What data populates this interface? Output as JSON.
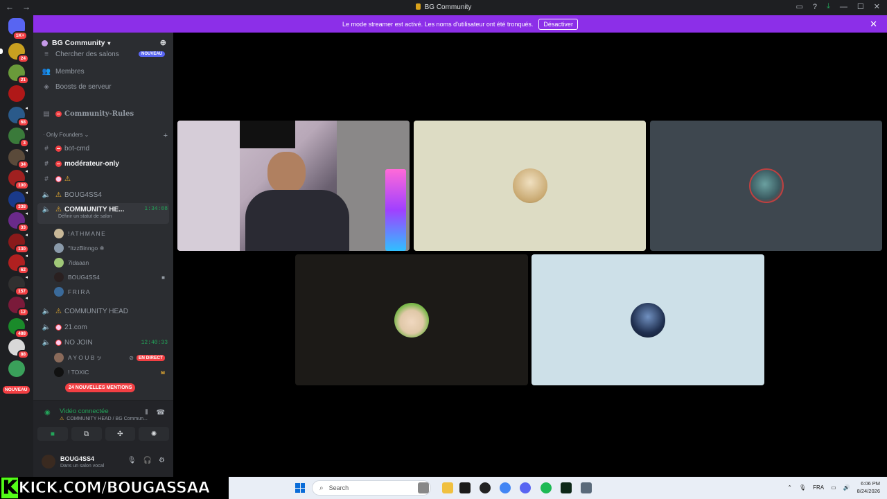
{
  "titlebar": {
    "title": "BG Community",
    "back": "←",
    "forward": "→"
  },
  "banner": {
    "text": "Le mode streamer est activé. Les noms d'utilisateur ont été tronqués.",
    "button": "Désactiver"
  },
  "guilds": {
    "home_badge": "1K+",
    "items": [
      {
        "badge": "24",
        "color": "#c8a020"
      },
      {
        "badge": "21",
        "color": "#6a9a3a"
      },
      {
        "badge": "",
        "color": "#b01818"
      },
      {
        "badge": "68",
        "color": "#2a5a8a"
      },
      {
        "badge": "3",
        "color": "#3a7a3a"
      },
      {
        "badge": "34",
        "color": "#5a4a3a"
      },
      {
        "badge": "100",
        "color": "#a02020"
      },
      {
        "badge": "338",
        "color": "#1a3a8a"
      },
      {
        "badge": "33",
        "color": "#6a2a8a"
      },
      {
        "badge": "130",
        "color": "#8a1a1a"
      },
      {
        "badge": "62",
        "color": "#b02020"
      },
      {
        "badge": "157",
        "color": "#303030"
      },
      {
        "badge": "12",
        "color": "#7a1a3a"
      },
      {
        "badge": "488",
        "color": "#1a8a2a"
      },
      {
        "badge": "88",
        "color": "#d8d8d8"
      },
      {
        "badge": "",
        "color": "#3aa05a"
      }
    ],
    "new_label": "NOUVEAU"
  },
  "server": {
    "name": "BG Community"
  },
  "sidebar": {
    "search_channels": "Chercher des salons",
    "nouveau": "NOUVEAU",
    "members": "Membres",
    "boosts": "Boosts de serveur",
    "rules": "Community-Rules",
    "category": "Only Founders",
    "channels": {
      "bot_cmd": "bot-cmd",
      "moderateur": "modérateur-only",
      "warn": "",
      "bougass4": "BOUG4SS4",
      "community_he": "COMMUNITY HE...",
      "community_he_timer": "1:34:08",
      "status_hint": "Définir un statut de salon",
      "community_head": "COMMUNITY HEAD",
      "c21": "21.com",
      "no_join": "NO JOIN",
      "no_join_timer": "12:40:33"
    },
    "users_community": [
      "!ATHMANE",
      "°ItzzBinngo ❄",
      "7idaaan",
      "BOUG4SS4",
      "FRIRA"
    ],
    "users_nojoin": [
      "A Y O U B ッ",
      "! TOXIC"
    ],
    "live": "EN DIRECT",
    "mentions": "24 NOUVELLES MENTIONS"
  },
  "voice": {
    "status": "Vidéo connectée",
    "location": "COMMUNITY HEAD / BG Commun..."
  },
  "user": {
    "name": "BOUG4SS4",
    "status": "Dans un salon vocal"
  },
  "overlay": {
    "kick": "KICK.COM/BOUGASSAA",
    "kick_letter": "K"
  },
  "taskbar": {
    "search": "Search",
    "lang": "FRA",
    "time": "6:06 PM",
    "date": "8/24/2026"
  },
  "colors": {
    "accent": "#8c2fe8",
    "green": "#23a55a",
    "red": "#f23f43"
  }
}
